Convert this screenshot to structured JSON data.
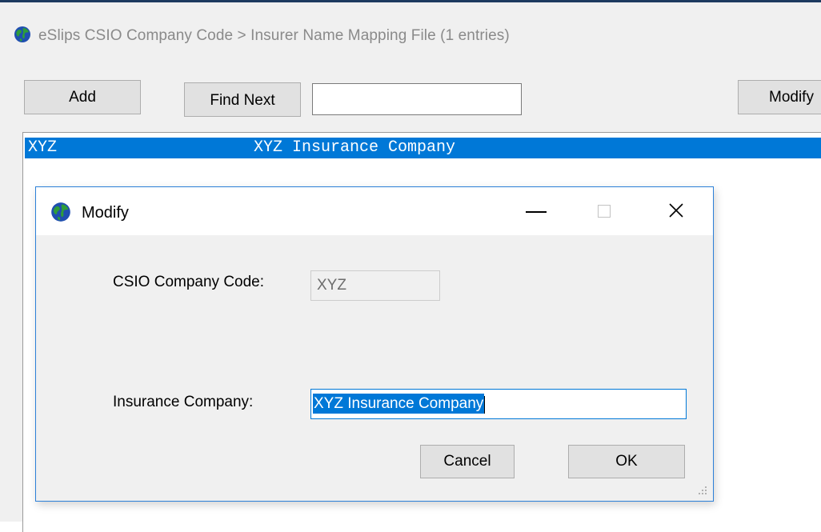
{
  "main": {
    "title": "eSlips CSIO Company Code > Insurer Name Mapping File (1 entries)",
    "toolbar": {
      "add_label": "Add",
      "find_next_label": "Find Next",
      "search_value": "",
      "modify_label": "Modify"
    },
    "list": {
      "rows": [
        {
          "code": "XYZ",
          "name": "XYZ Insurance Company",
          "selected": true
        }
      ]
    }
  },
  "dialog": {
    "title": "Modify",
    "icons": {
      "app": "globe-icon",
      "minimize": "minimize-icon",
      "maximize": "maximize-icon",
      "close": "close-icon"
    },
    "fields": {
      "code_label": "CSIO Company Code:",
      "code_value": "XYZ",
      "company_label": "Insurance Company:",
      "company_value": "XYZ Insurance Company"
    },
    "buttons": {
      "cancel_label": "Cancel",
      "ok_label": "OK"
    }
  },
  "colors": {
    "selection": "#0078d7",
    "dialog_border": "#2c80d8",
    "window_bg": "#f0f0f0",
    "button_bg": "#e1e1e1"
  }
}
